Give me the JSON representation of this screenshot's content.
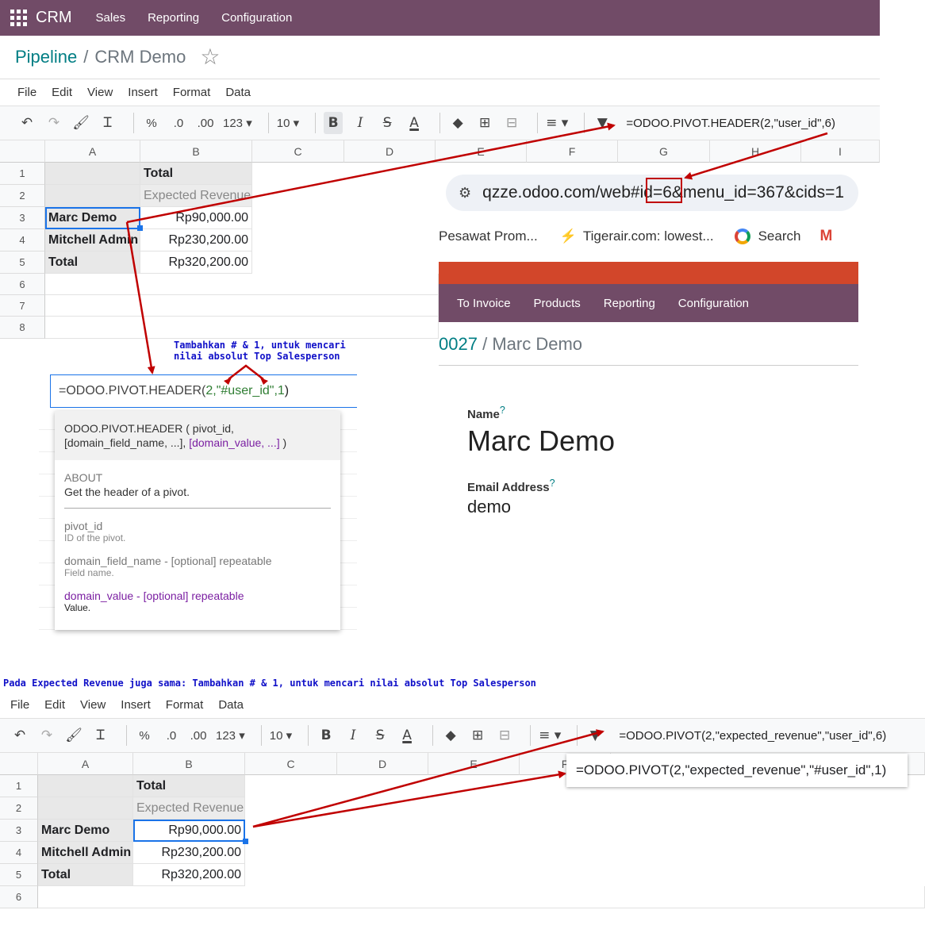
{
  "odoo": {
    "brand": "CRM",
    "nav": [
      "Sales",
      "Reporting",
      "Configuration"
    ],
    "breadcrumb": {
      "parent": "Pipeline",
      "separator": "/",
      "current": "CRM Demo"
    }
  },
  "sheet1": {
    "menu": [
      "File",
      "Edit",
      "View",
      "Insert",
      "Format",
      "Data"
    ],
    "toolbar": {
      "percent": "%",
      "dec0": ".0",
      "dec00": ".00",
      "numfmt": "123",
      "font_size": "10"
    },
    "formula": "=ODOO.PIVOT.HEADER(2,\"user_id\",6)",
    "columns": [
      "A",
      "B",
      "C",
      "D",
      "E",
      "F",
      "G",
      "H",
      "I"
    ],
    "rows": [
      "1",
      "2",
      "3",
      "4",
      "5",
      "6",
      "7",
      "8"
    ],
    "cells": {
      "b1": "Total",
      "b2": "Expected Revenue",
      "a3": "Marc Demo",
      "b3": "Rp90,000.00",
      "a4": "Mitchell Admin",
      "b4": "Rp230,200.00",
      "a5": "Total",
      "b5": "Rp320,200.00"
    }
  },
  "browser": {
    "url": "qzze.odoo.com/web#id=6&menu_id=367&cids=1",
    "bookmarks": [
      "Pesawat Prom...",
      "Tigerair.com: lowest...",
      "Search"
    ],
    "nav": [
      "To Invoice",
      "Products",
      "Reporting",
      "Configuration"
    ],
    "breadcrumb": {
      "parent": "0027",
      "separator": "/",
      "current": "Marc Demo"
    },
    "name_label": "Name",
    "name_value": "Marc Demo",
    "email_label": "Email Address",
    "email_value": "demo",
    "help_mark": "?"
  },
  "annotation1": {
    "line1": "Tambahkan # & 1, untuk mencari",
    "line2": "nilai absolut Top Salesperson"
  },
  "edit_formula": {
    "prefix": "=ODOO.PIVOT.HEADER(",
    "arg1": "2,",
    "arg2": "\"#user_id\"",
    "arg3": ",1",
    "suffix": ")"
  },
  "popup": {
    "sig_line1": "ODOO.PIVOT.HEADER ( pivot_id,",
    "sig_line2a": "[domain_field_name, ...],",
    "sig_line2b": "[domain_value, ...]",
    "sig_line2c": ")",
    "about_label": "ABOUT",
    "about_text": "Get the header of a pivot.",
    "p1_name": "pivot_id",
    "p1_desc": "ID of the pivot.",
    "p2_name": "domain_field_name - [optional] repeatable",
    "p2_desc": "Field name.",
    "p3_name": "domain_value - [optional] repeatable",
    "p3_desc": "Value."
  },
  "annotation2": "Pada Expected Revenue juga sama: Tambahkan # & 1, untuk mencari nilai absolut Top Salesperson",
  "sheet2": {
    "menu": [
      "File",
      "Edit",
      "View",
      "Insert",
      "Format",
      "Data"
    ],
    "formula": "=ODOO.PIVOT(2,\"expected_revenue\",\"user_id\",6)",
    "formula_new": "=ODOO.PIVOT(2,\"expected_revenue\",\"#user_id\",1)",
    "columns": [
      "A",
      "B",
      "C",
      "D",
      "E",
      "F"
    ],
    "rows": [
      "1",
      "2",
      "3",
      "4",
      "5",
      "6"
    ],
    "cells": {
      "b1": "Total",
      "b2": "Expected Revenue",
      "a3": "Marc Demo",
      "b3": "Rp90,000.00",
      "a4": "Mitchell Admin",
      "b4": "Rp230,200.00",
      "a5": "Total",
      "b5": "Rp320,200.00"
    }
  },
  "colors": {
    "odoo_purple": "#714b67",
    "odoo_teal": "#017e84",
    "arrow_red": "#c00000",
    "note_blue": "#1010c8"
  }
}
